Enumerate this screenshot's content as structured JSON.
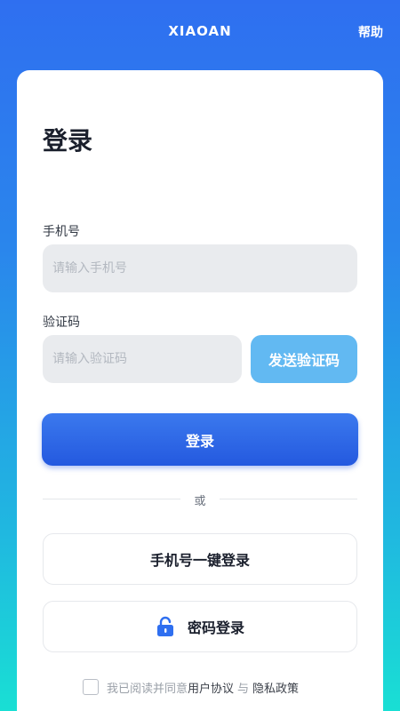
{
  "header": {
    "brand": "XIAOAN",
    "help_label": "帮助"
  },
  "login": {
    "title": "登录",
    "phone": {
      "label": "手机号",
      "placeholder": "请输入手机号",
      "value": ""
    },
    "code": {
      "label": "验证码",
      "placeholder": "请输入验证码",
      "value": "",
      "send_label": "发送验证码"
    },
    "submit_label": "登录",
    "divider_text": "或",
    "one_click_label": "手机号一键登录",
    "password_login_label": "密码登录",
    "agreement": {
      "prefix": "我已阅读并同意",
      "user_agreement": "用户协议",
      "and": "与",
      "privacy_policy": "隐私政策",
      "checked": false
    }
  },
  "colors": {
    "primary": "#2f6ff0",
    "send_button": "#62b9f2",
    "lock_icon": "#2f6ff0"
  },
  "icons": {
    "password_login": "lock-open-icon"
  }
}
